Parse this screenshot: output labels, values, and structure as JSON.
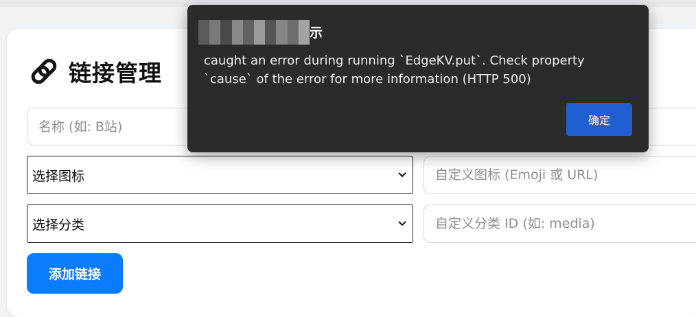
{
  "header": {
    "title": "链接管理",
    "logo_icon": "link-icon"
  },
  "form": {
    "name_placeholder": "名称 (如: B站)",
    "icon_select_value": "选择图标",
    "custom_icon_placeholder": "自定义图标 (Emoji 或 URL)",
    "category_select_value": "选择分类",
    "custom_category_placeholder": "自定义分类 ID (如: media)",
    "add_button_label": "添加链接"
  },
  "dialog": {
    "title_visible": "示",
    "message": "caught an error during running `EdgeKV.put`. Check property `cause` of the error for more information (HTTP 500)",
    "ok_label": "确定"
  },
  "colors": {
    "primary": "#0a7cff",
    "dialog_bg": "#2b2b2b",
    "dialog_button": "#1f5fd0"
  }
}
